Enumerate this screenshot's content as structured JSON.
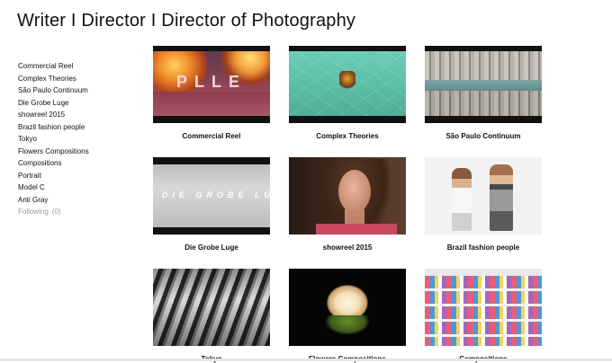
{
  "header": {
    "title": "Writer I Director I Director of Photography"
  },
  "sidebar": {
    "items": [
      {
        "label": "Commercial Reel"
      },
      {
        "label": "Complex Theories"
      },
      {
        "label": "São Paulo Continuum"
      },
      {
        "label": "Die Grobe Luge"
      },
      {
        "label": "showreel 2015"
      },
      {
        "label": "Brazil fashion people"
      },
      {
        "label": "Tokyo"
      },
      {
        "label": "Flowers Compositions"
      },
      {
        "label": "Compositions"
      },
      {
        "label": "Portrait"
      },
      {
        "label": "Model C"
      },
      {
        "label": "Anti Gray"
      }
    ],
    "following": {
      "label": "Following",
      "count": "(0)"
    }
  },
  "grid": {
    "tiles": [
      {
        "title": "Commercial Reel",
        "logo_text": "PLLE"
      },
      {
        "title": "Complex Theories"
      },
      {
        "title": "São Paulo Continuum"
      },
      {
        "title": "Die Grobe Luge",
        "overlay_text": "DIE GROBE LÜ"
      },
      {
        "title": "showreel 2015"
      },
      {
        "title": "Brazil fashion people"
      },
      {
        "title": "Tokyo"
      },
      {
        "title": "Flowers Compositions"
      },
      {
        "title": "Compositions"
      }
    ]
  },
  "colors": {
    "background": "#ffffff",
    "text": "#111111",
    "muted": "#9a9a9a"
  }
}
